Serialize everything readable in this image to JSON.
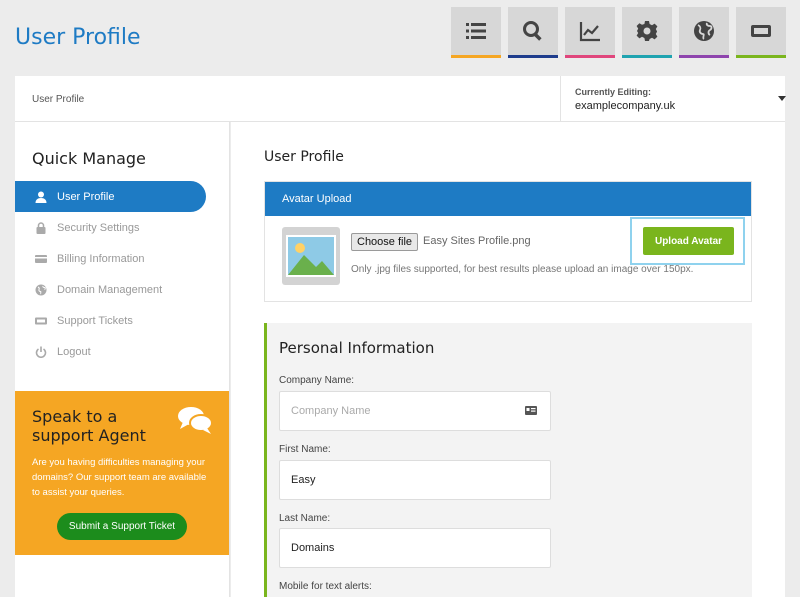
{
  "page": {
    "title": "User Profile"
  },
  "toolbar": {
    "items": [
      {
        "icon": "list-icon",
        "color": "#f5a623"
      },
      {
        "icon": "search-icon",
        "color": "#1e3c8c"
      },
      {
        "icon": "chart-icon",
        "color": "#e0467c"
      },
      {
        "icon": "gear-icon",
        "color": "#1fa3b0"
      },
      {
        "icon": "globe-icon",
        "color": "#8e44ad"
      },
      {
        "icon": "ticket-icon",
        "color": "#7ab51d"
      }
    ]
  },
  "breadcrumb": {
    "current": "User Profile",
    "editing_label": "Currently Editing:",
    "editing_value": "examplecompany.uk"
  },
  "quick_manage": {
    "title": "Quick Manage",
    "items": [
      {
        "label": "User Profile",
        "icon": "user-icon",
        "active": true
      },
      {
        "label": "Security Settings",
        "icon": "lock-icon",
        "active": false
      },
      {
        "label": "Billing Information",
        "icon": "credit-card-icon",
        "active": false
      },
      {
        "label": "Domain Management",
        "icon": "globe-icon",
        "active": false
      },
      {
        "label": "Support Tickets",
        "icon": "ticket-icon",
        "active": false
      },
      {
        "label": "Logout",
        "icon": "power-icon",
        "active": false
      }
    ]
  },
  "support": {
    "title": "Speak to a support Agent",
    "text": "Are you having difficulties managing your domains? Our support team are available to assist your queries.",
    "button": "Submit a Support Ticket"
  },
  "main": {
    "title": "User Profile",
    "avatar": {
      "header": "Avatar Upload",
      "choose_file": "Choose file",
      "file_name": "Easy Sites Profile.png",
      "hint": "Only .jpg files supported, for best results please upload an image over 150px.",
      "upload_button": "Upload Avatar"
    },
    "personal": {
      "title": "Personal Information",
      "company_label": "Company Name:",
      "company_placeholder": "Company Name",
      "first_label": "First Name:",
      "first_value": "Easy",
      "last_label": "Last Name:",
      "last_value": "Domains",
      "mobile_label": "Mobile for text alerts:"
    }
  },
  "colors": {
    "primary": "#1e7bc4",
    "accent_orange": "#f5a623",
    "accent_green": "#7ab51d",
    "support_button": "#1c8c1c"
  }
}
